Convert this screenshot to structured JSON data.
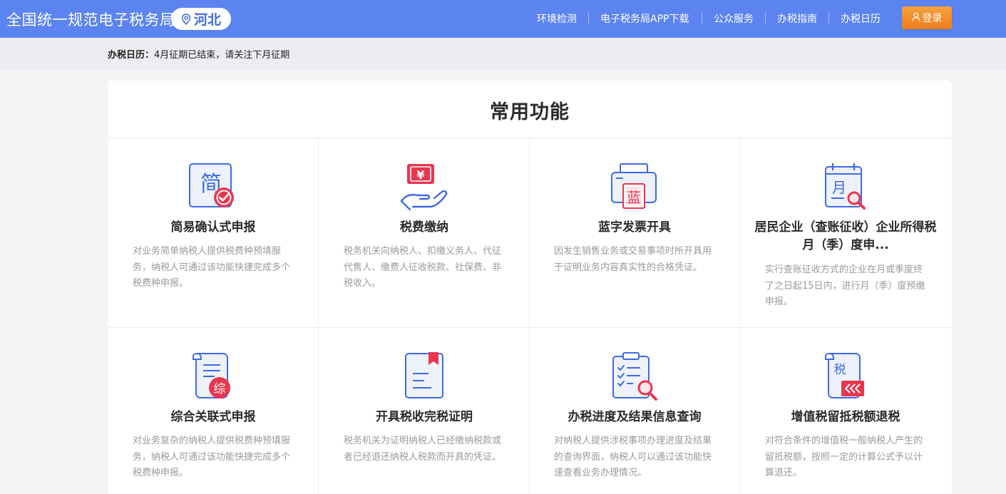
{
  "header": {
    "site_title": "全国统一规范电子税务局",
    "region": "河北",
    "nav": [
      "环境检测",
      "电子税务局APP下载",
      "公众服务",
      "办税指南",
      "办税日历"
    ],
    "login_label": "登录"
  },
  "calendar": {
    "label": "办税日历：",
    "text": "4月征期已结束，请关注下月征期"
  },
  "main": {
    "title": "常用功能",
    "tiles": [
      {
        "title": "简易确认式申报",
        "desc": "对业务简单纳税人提供税费种预填服务，纳税人可通过该功能快捷完成多个税费种申报。",
        "icon": "jian-declare-icon"
      },
      {
        "title": "税费缴纳",
        "desc": "税务机关向纳税人、扣缴义务人、代征代售人、缴费人征收税款、社保费、非税收入。",
        "icon": "yuan-hand-icon"
      },
      {
        "title": "蓝字发票开具",
        "desc": "因发生销售业务或交易事项时所开具用于证明业务内容真实性的合格凭证。",
        "icon": "printer-lan-icon"
      },
      {
        "title": "居民企业（查账征收）企业所得税月（季）度申...",
        "desc": "实行查账征收方式的企业在月或季度终了之日起15日内，进行月（季）度预缴申报。",
        "icon": "calendar-search-icon"
      },
      {
        "title": "综合关联式申报",
        "desc": "对业务复杂的纳税人提供税费种预填服务，纳税人可通过该功能快捷完成多个税费种申报。",
        "icon": "scroll-zong-icon"
      },
      {
        "title": "开具税收完税证明",
        "desc": "税务机关为证明纳税人已经缴纳税款或者已经退还纳税人税款而开具的凭证。",
        "icon": "bookmark-document-icon"
      },
      {
        "title": "办税进度及结果信息查询",
        "desc": "对纳税人提供涉税事项办理进度及结果的查询界面，纳税人可以通过该功能快速查看业务办理情况。",
        "icon": "clipboard-search-icon"
      },
      {
        "title": "增值税留抵税额退税",
        "desc": "对符合条件的增值税一般纳税人产生的留抵税额，按照一定的计算公式予以计算退还。",
        "icon": "shui-refund-icon"
      }
    ]
  },
  "colors": {
    "topbar": "#5b84f0",
    "accent_blue": "#3f6ae6",
    "accent_red": "#e8364f",
    "login_orange": "#f08a2a"
  }
}
